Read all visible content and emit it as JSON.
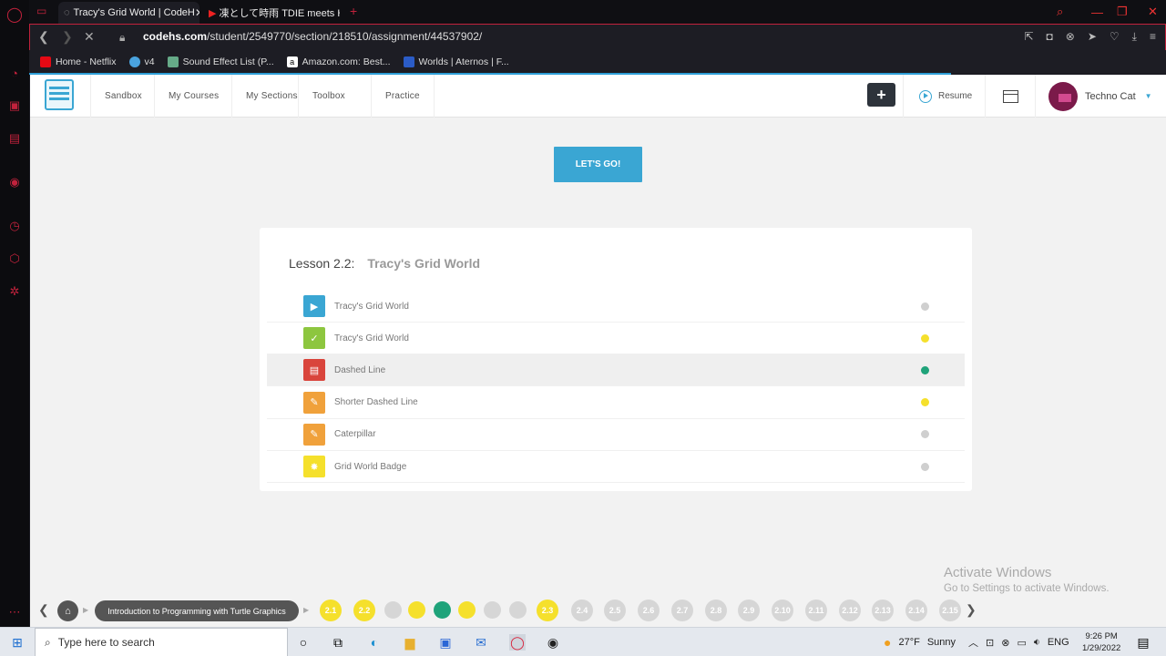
{
  "browser": {
    "tabs": [
      {
        "title": "Tracy's Grid World | CodeH",
        "active": true
      },
      {
        "title": "凍として時雨 TDIE meets HA",
        "active": false
      }
    ],
    "url_host": "codehs.com",
    "url_path": "/student/2549770/section/218510/assignment/44537902/",
    "bookmarks": [
      "Home - Netflix",
      "v4",
      "Sound Effect List (P...",
      "Amazon.com: Best...",
      "Worlds | Aternos | F..."
    ]
  },
  "nav": {
    "items": [
      "Sandbox",
      "My Courses",
      "My Sections",
      "Toolbox",
      "Practice"
    ],
    "resume": "Resume",
    "user": "Techno Cat"
  },
  "main": {
    "letsgo": "LET'S GO!",
    "lesson_prefix": "Lesson 2.2:",
    "lesson_title": "Tracy's Grid World",
    "items": [
      {
        "label": "Tracy's Grid World",
        "icon": "video-icon",
        "color": "#3aa6d3",
        "status": "#cfcfcf"
      },
      {
        "label": "Tracy's Grid World",
        "icon": "check-icon",
        "color": "#8dc63f",
        "status": "#f5e02c"
      },
      {
        "label": "Dashed Line",
        "icon": "document-icon",
        "color": "#d9453c",
        "status": "#1fa37a"
      },
      {
        "label": "Shorter Dashed Line",
        "icon": "pencil-icon",
        "color": "#f0a13b",
        "status": "#f5e02c"
      },
      {
        "label": "Caterpillar",
        "icon": "pencil-icon",
        "color": "#f0a13b",
        "status": "#cfcfcf"
      },
      {
        "label": "Grid World Badge",
        "icon": "badge-icon",
        "color": "#f5e02c",
        "status": "#cfcfcf"
      }
    ]
  },
  "progress": {
    "course": "Introduction to Programming with Turtle Graphics",
    "sections": [
      "2.1",
      "2.2",
      "",
      "",
      "",
      "",
      "",
      "",
      "2.3",
      "2.4",
      "2.5",
      "2.6",
      "2.7",
      "2.8",
      "2.9",
      "2.10",
      "2.11",
      "2.12",
      "2.13",
      "2.14",
      "2.15"
    ]
  },
  "watermark": {
    "title": "Activate Windows",
    "subtitle": "Go to Settings to activate Windows."
  },
  "taskbar": {
    "search_placeholder": "Type here to search",
    "weather_temp": "27°F",
    "weather_text": "Sunny",
    "lang": "ENG",
    "time": "9:26 PM",
    "date": "1/29/2022"
  }
}
